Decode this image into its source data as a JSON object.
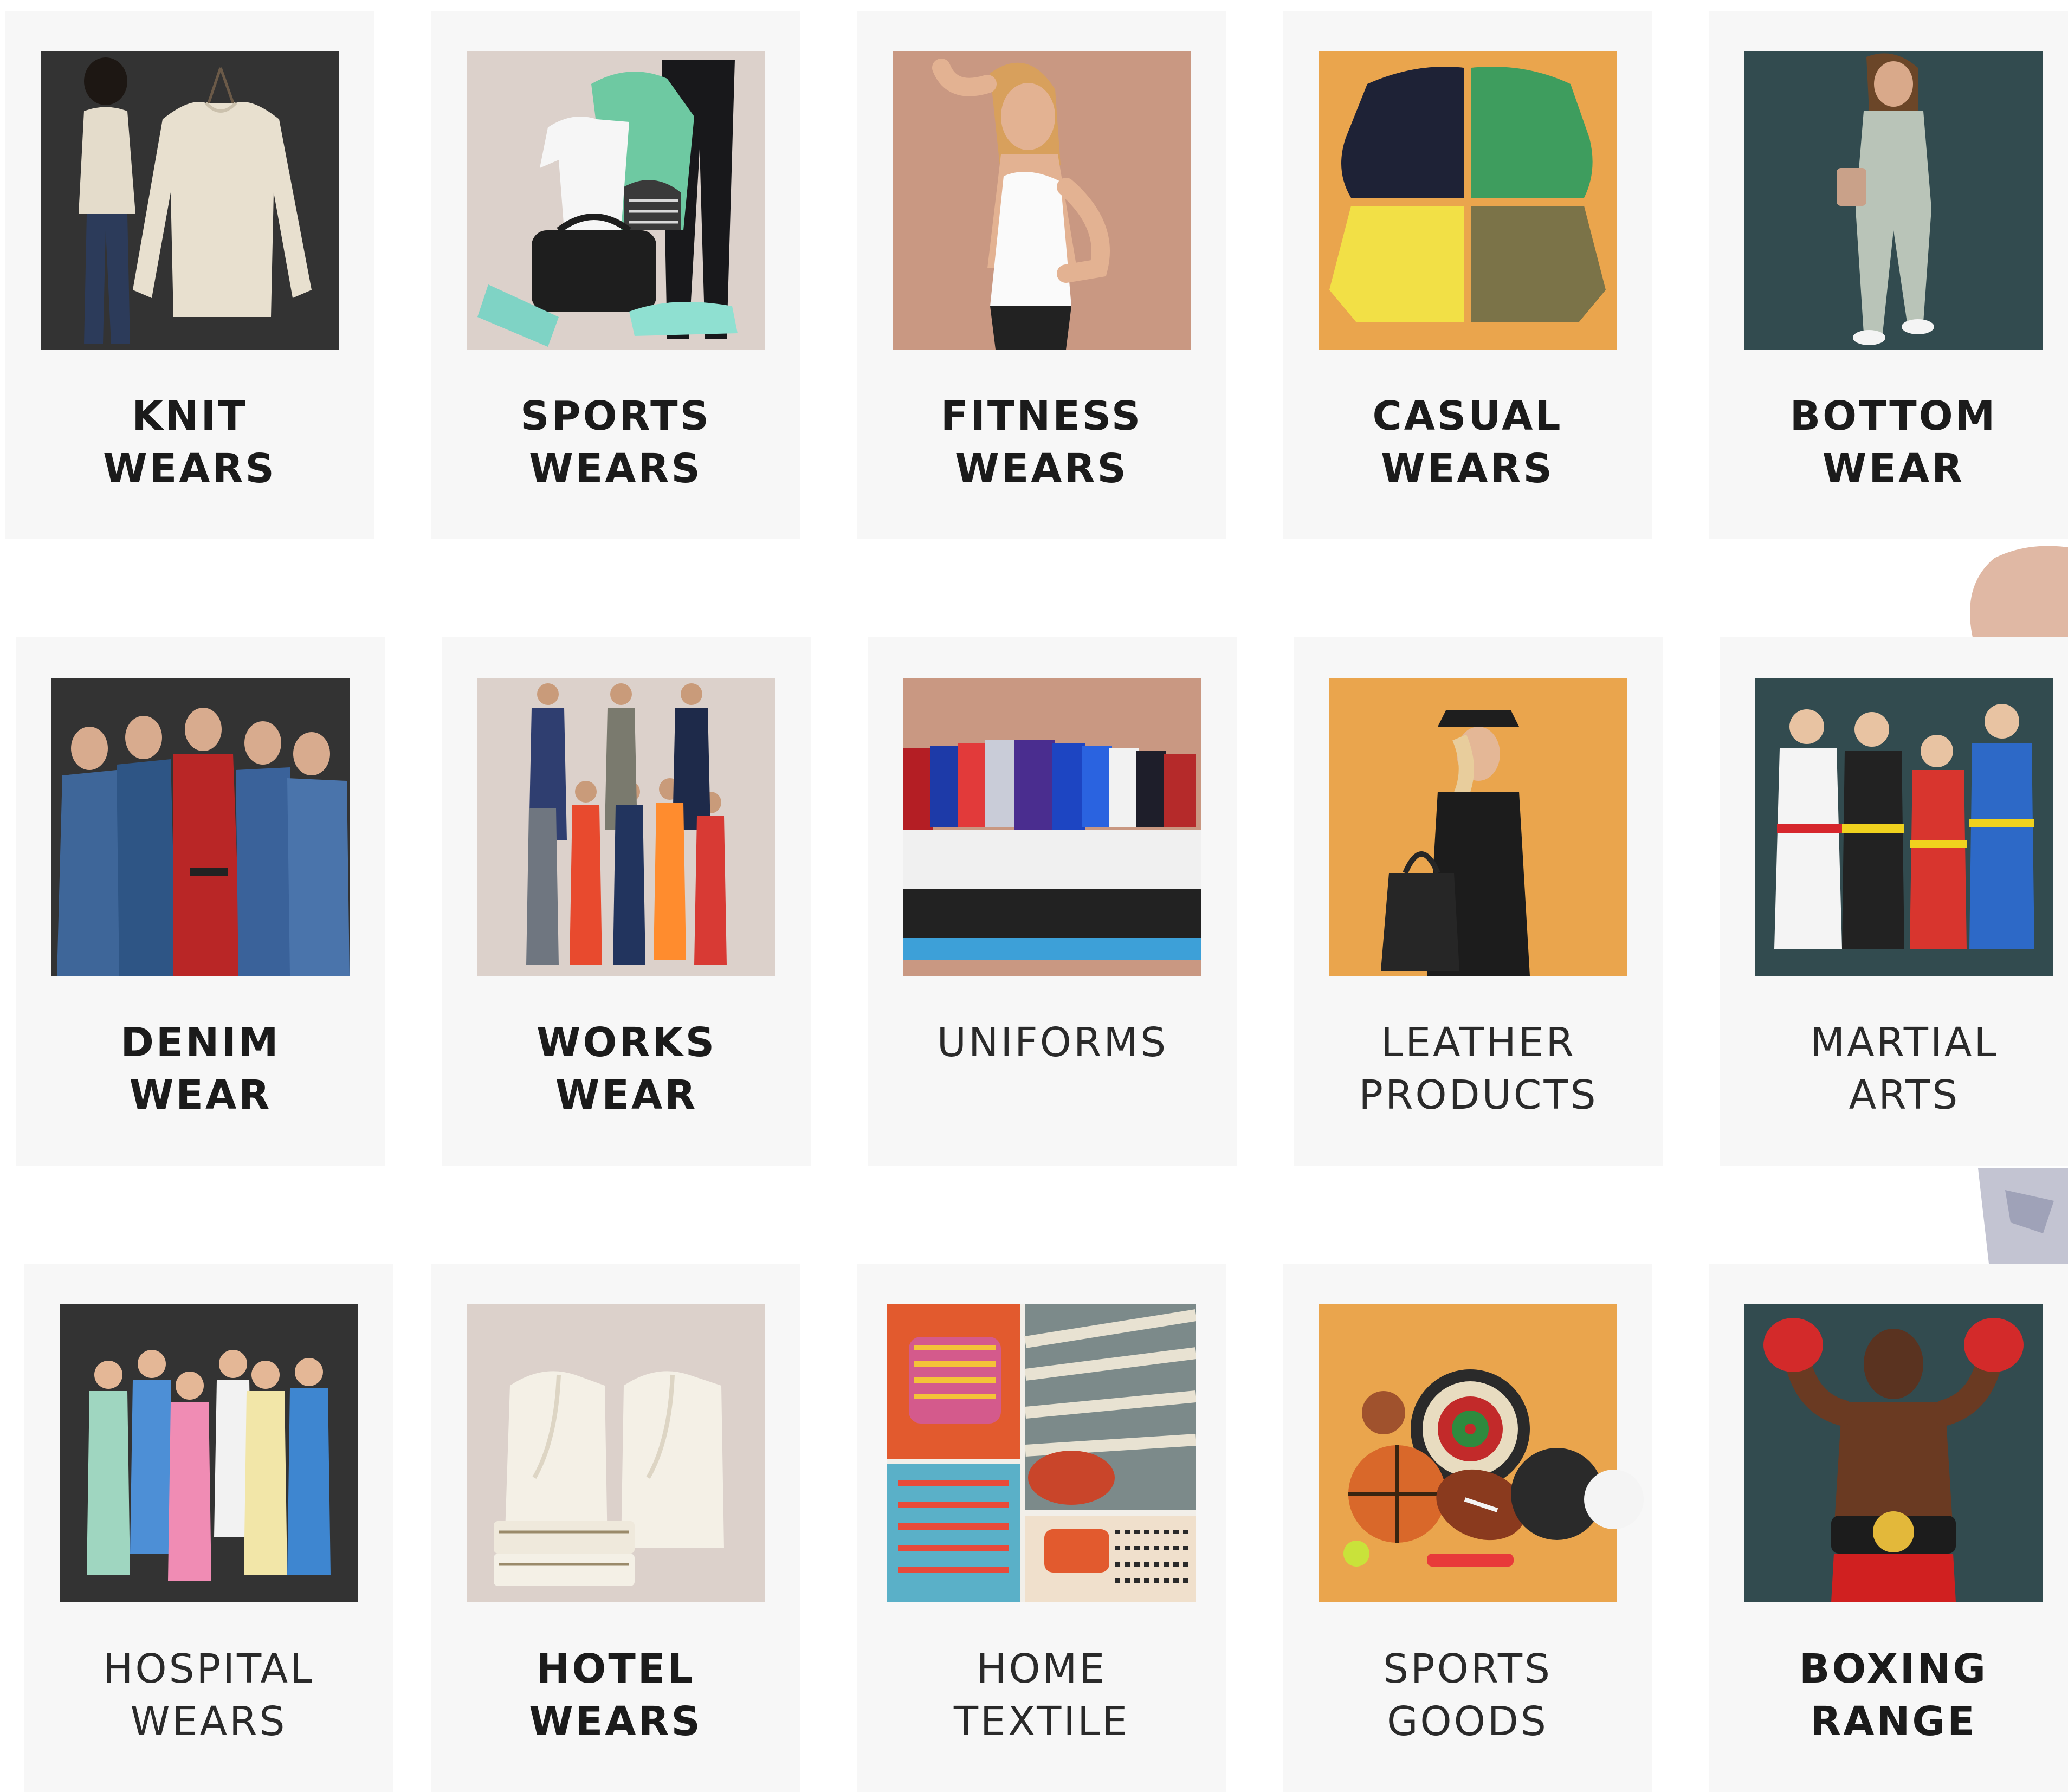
{
  "categories": [
    {
      "line1": "KNIT",
      "line2": "WEARS",
      "bg": "#333333"
    },
    {
      "line1": "SPORTS",
      "line2": "WEARS",
      "bg": "#dcd1cb"
    },
    {
      "line1": "FITNESS",
      "line2": "WEARS",
      "bg": "#c99882"
    },
    {
      "line1": "CASUAL",
      "line2": "WEARS",
      "bg": "#eaa54d"
    },
    {
      "line1": "BOTTOM",
      "line2": "WEAR",
      "bg": "#324b4f"
    },
    {
      "line1": "DENIM",
      "line2": "WEAR",
      "bg": "#333333"
    },
    {
      "line1": "WORKS",
      "line2": "WEAR",
      "bg": "#dcd1cb"
    },
    {
      "line1": "UNIFORMS",
      "line2": "",
      "bg": "#c99882"
    },
    {
      "line1": "LEATHER",
      "line2": "PRODUCTS",
      "bg": "#eaa54d"
    },
    {
      "line1": "MARTIAL",
      "line2": "ARTS",
      "bg": "#324b4f"
    },
    {
      "line1": "HOSPITAL",
      "line2": "WEARS",
      "bg": "#333333"
    },
    {
      "line1": "HOTEL",
      "line2": "WEARS",
      "bg": "#dcd1cb"
    },
    {
      "line1": "HOME",
      "line2": "TEXTILE",
      "bg": "#c99882"
    },
    {
      "line1": "SPORTS",
      "line2": "GOODS",
      "bg": "#eaa54d"
    },
    {
      "line1": "BOXING",
      "line2": "RANGE",
      "bg": "#324b4f"
    }
  ]
}
